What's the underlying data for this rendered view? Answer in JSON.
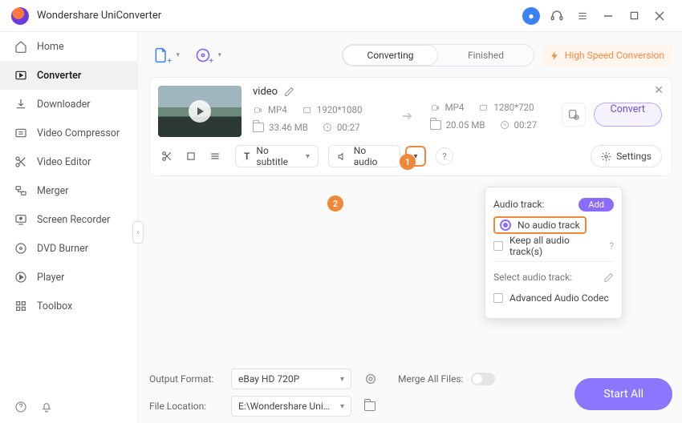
{
  "app": {
    "title": "Wondershare UniConverter"
  },
  "sidebar": {
    "items": [
      {
        "label": "Home"
      },
      {
        "label": "Converter"
      },
      {
        "label": "Downloader"
      },
      {
        "label": "Video Compressor"
      },
      {
        "label": "Video Editor"
      },
      {
        "label": "Merger"
      },
      {
        "label": "Screen Recorder"
      },
      {
        "label": "DVD Burner"
      },
      {
        "label": "Player"
      },
      {
        "label": "Toolbox"
      }
    ]
  },
  "tabs": {
    "converting": "Converting",
    "finished": "Finished"
  },
  "hsc": "High Speed Conversion",
  "card": {
    "title": "video",
    "src": {
      "format": "MP4",
      "res": "1920*1080",
      "size": "33.46 MB",
      "dur": "00:27"
    },
    "dst": {
      "format": "MP4",
      "res": "1280*720",
      "size": "20.05 MB",
      "dur": "00:27"
    },
    "convert": "Convert",
    "subtitle": "No subtitle",
    "audio": "No audio",
    "settings": "Settings"
  },
  "badges": {
    "one": "1",
    "two": "2"
  },
  "popup": {
    "header": "Audio track:",
    "add": "Add",
    "no_audio": "No audio track",
    "keep": "Keep all audio track(s)",
    "select": "Select audio track:",
    "advanced": "Advanced Audio Codec"
  },
  "footer": {
    "out_label": "Output Format:",
    "out_value": "eBay HD 720P",
    "merge_label": "Merge All Files:",
    "loc_label": "File Location:",
    "loc_value": "E:\\Wondershare UniConverter",
    "start": "Start All"
  }
}
